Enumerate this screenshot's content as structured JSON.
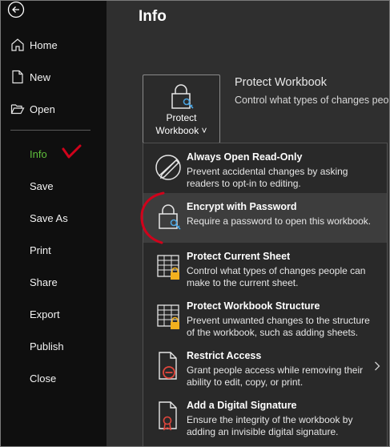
{
  "sidebar": {
    "back_label": "",
    "items": [
      {
        "label": "Home",
        "icon": "home-icon"
      },
      {
        "label": "New",
        "icon": "new-document-icon"
      },
      {
        "label": "Open",
        "icon": "open-folder-icon"
      },
      {
        "label": "Info",
        "active": true
      },
      {
        "label": "Save"
      },
      {
        "label": "Save As"
      },
      {
        "label": "Print"
      },
      {
        "label": "Share"
      },
      {
        "label": "Export"
      },
      {
        "label": "Publish"
      },
      {
        "label": "Close"
      }
    ]
  },
  "main": {
    "title": "Info",
    "protect_button": {
      "line1": "Protect",
      "line2": "Workbook ˅"
    },
    "section_title": "Protect Workbook",
    "section_desc": "Control what types of changes people"
  },
  "menu": {
    "items": [
      {
        "title": "Always Open Read-Only",
        "desc": "Prevent accidental changes by asking readers to opt-in to editing.",
        "icon": "read-only-pencil-icon"
      },
      {
        "title": "Encrypt with Password",
        "desc": "Require a password to open this workbook.",
        "icon": "lock-key-icon"
      },
      {
        "title": "Protect Current Sheet",
        "desc": "Control what types of changes people can make to the current sheet.",
        "icon": "sheet-lock-icon"
      },
      {
        "title": "Protect Workbook Structure",
        "desc": "Prevent unwanted changes to the structure of the workbook, such as adding sheets.",
        "icon": "workbook-structure-lock-icon"
      },
      {
        "title": "Restrict Access",
        "desc": "Grant people access while removing their ability to edit, copy, or print.",
        "icon": "restrict-access-icon"
      },
      {
        "title": "Add a Digital Signature",
        "desc": "Ensure the integrity of the workbook by adding an invisible digital signature.",
        "icon": "digital-signature-icon"
      }
    ]
  },
  "colors": {
    "sidebar_bg": "#0f0f0f",
    "main_bg": "#2f2f2f",
    "active_green": "#5fbf3c",
    "annotation_red": "#d0021b",
    "lock_accent": "#f2b01e",
    "key_accent": "#4aa3df"
  }
}
